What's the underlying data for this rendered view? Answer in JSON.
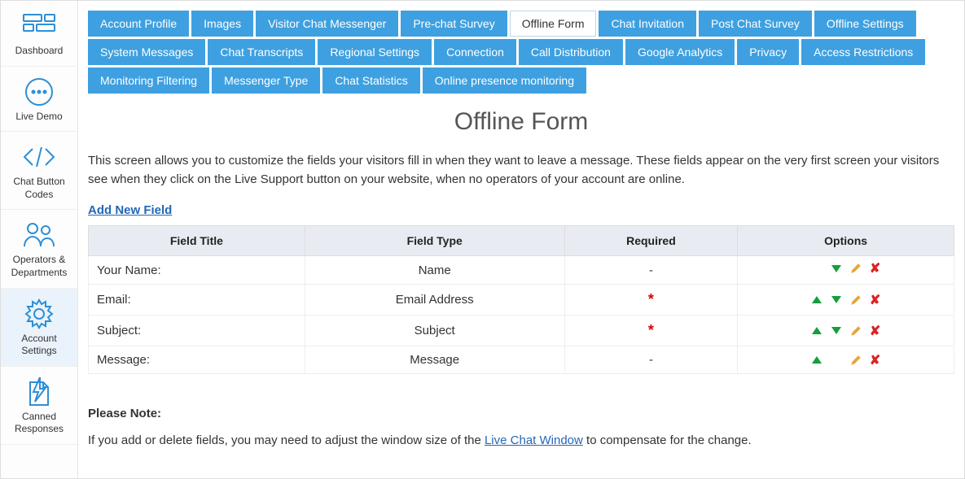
{
  "sidebar": {
    "items": [
      {
        "label": "Dashboard",
        "icon": "dashboard"
      },
      {
        "label": "Live Demo",
        "icon": "chat"
      },
      {
        "label": "Chat Button Codes",
        "icon": "code"
      },
      {
        "label": "Operators & Departments",
        "icon": "people"
      },
      {
        "label": "Account Settings",
        "icon": "gear",
        "active": true
      },
      {
        "label": "Canned Responses",
        "icon": "lightning"
      }
    ]
  },
  "tabs": {
    "row1": [
      "Account Profile",
      "Images",
      "Visitor Chat Messenger",
      "Pre-chat Survey",
      "Offline Form",
      "Chat Invitation",
      "Post Chat Survey",
      "Offline Settings",
      "System Messages",
      "Chat Transcripts"
    ],
    "row2": [
      "Regional Settings",
      "Connection",
      "Call Distribution",
      "Google Analytics",
      "Privacy",
      "Access Restrictions",
      "Monitoring Filtering",
      "Messenger Type",
      "Chat Statistics",
      "Online presence monitoring"
    ],
    "active": "Offline Form"
  },
  "page": {
    "title": "Offline Form",
    "description": "This screen allows you to customize the fields your visitors fill in when they want to leave a message. These fields appear on the very first screen your visitors see when they click on the Live Support button on your website, when no operators of your account are online.",
    "add_link": "Add New Field",
    "table": {
      "headers": {
        "title": "Field Title",
        "type": "Field Type",
        "required": "Required",
        "options": "Options"
      },
      "rows": [
        {
          "title": "Your Name:",
          "type": "Name",
          "required": "-",
          "up": false,
          "down": true
        },
        {
          "title": "Email:",
          "type": "Email Address",
          "required": "*",
          "up": true,
          "down": true
        },
        {
          "title": "Subject:",
          "type": "Subject",
          "required": "*",
          "up": true,
          "down": true
        },
        {
          "title": "Message:",
          "type": "Message",
          "required": "-",
          "up": true,
          "down": false
        }
      ]
    },
    "note": {
      "heading": "Please Note:",
      "before": "If you add or delete fields, you may need to adjust the window size of the ",
      "link": "Live Chat Window",
      "after": " to compensate for the change."
    }
  }
}
